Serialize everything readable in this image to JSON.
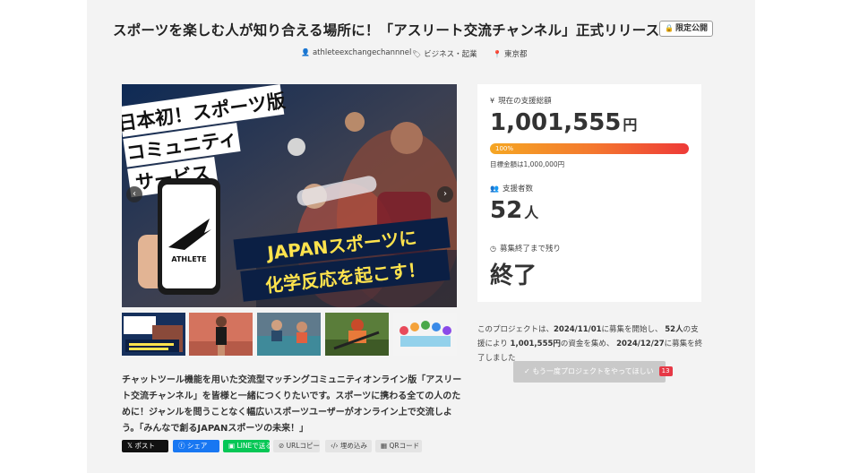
{
  "project": {
    "title": "スポーツを楽しむ人が知り合える場所に！「アスリート交流チャンネル」正式リリース！",
    "badge": "限定公開",
    "owner": "athleteexchangechannnel",
    "category": "ビジネス・起業",
    "location": "東京都"
  },
  "hero": {
    "headline_lines": [
      "日本初！スポーツ版",
      "コミュニティ",
      "サービス"
    ],
    "slogan_lines": [
      "JAPANスポーツに",
      "化学反応を起こす！"
    ],
    "phone_logo": "ATHLETE",
    "prev_icon": "‹",
    "next_icon": "›"
  },
  "description": "チャットツール機能を用いた交流型マッチングコミュニティオンライン版「アスリート交流チャンネル」を皆様と一緒につくりたいです。スポーツに携わる全ての人のために！ジャンルを問うことなく幅広いスポーツユーザーがオンライン上で交流しよう。「みんなで創るJAPANスポーツの未来！」",
  "share": {
    "x": "ポスト",
    "facebook": "シェア",
    "line": "LINEで送る",
    "url_copy": "URLコピー",
    "embed": "埋め込み",
    "qr": "QRコード"
  },
  "stats": {
    "total_label": "現在の支援総額",
    "total_value": "1,001,555",
    "currency": "円",
    "progress_text": "100%",
    "progress_fraction": 1.0,
    "goal_text": "目標金額は1,000,000円",
    "backers_label": "支援者数",
    "backers_value": "52",
    "backers_unit": "人",
    "remaining_label": "募集終了まで残り",
    "remaining_value": "終了"
  },
  "summary": {
    "p1": "このプロジェクトは、",
    "start": "2024/11/01",
    "p2": "に募集を開始し、",
    "backers": "52人",
    "p3": "の支援により",
    "amount": "1,001,555円",
    "p4": "の資金を集め、",
    "end": "2024/12/27",
    "p5": "に募集を終了しました"
  },
  "again_button": {
    "label": "もう一度プロジェクトをやってほしい",
    "count": "13"
  },
  "colors": {
    "progress_start": "#f5a623",
    "progress_end": "#ee3a38",
    "facebook": "#1877f2",
    "line": "#06c755",
    "badge_red": "#e63946"
  }
}
